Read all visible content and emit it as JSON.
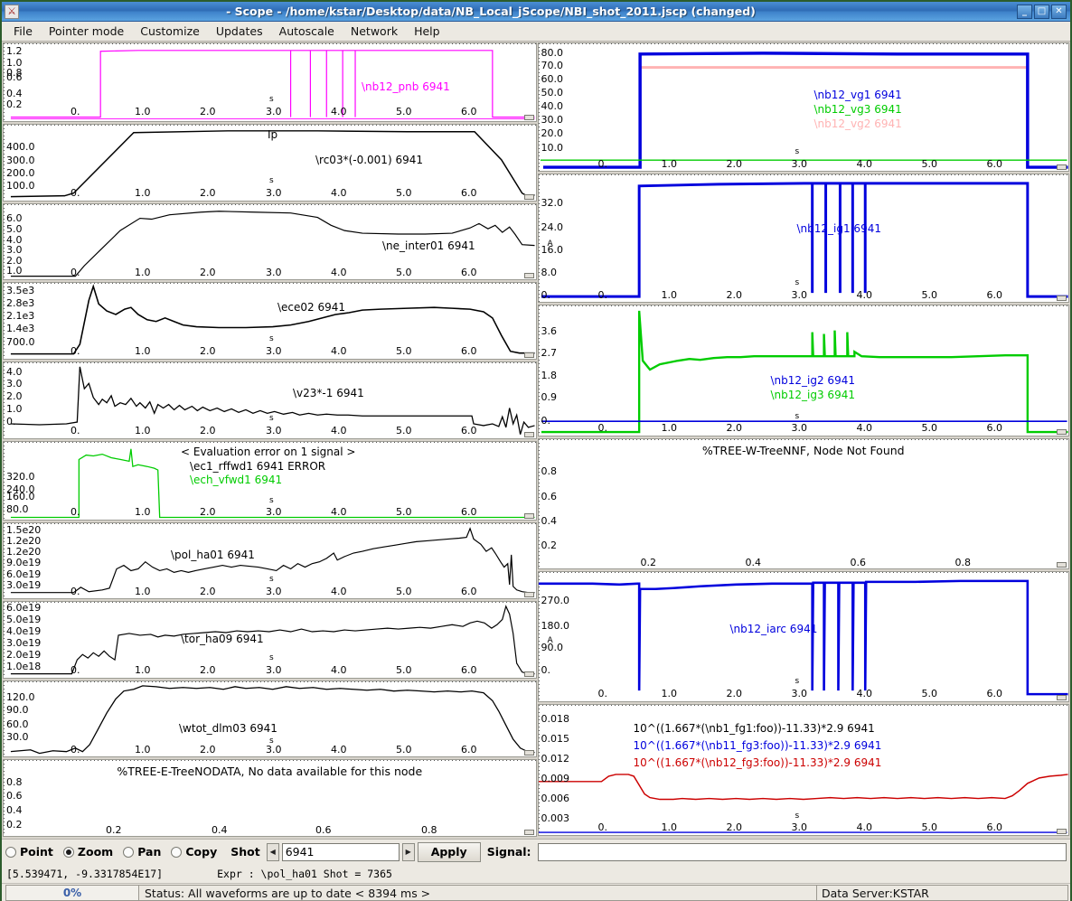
{
  "window": {
    "title": "- Scope - /home/kstar/Desktop/data/NB_Local_jScope/NBI_shot_2011.jscp (changed)",
    "minimize": "_",
    "maximize": "□",
    "close": "✕",
    "app_icon": "scope-app-icon"
  },
  "menu": [
    {
      "label": "File"
    },
    {
      "label": "Pointer mode"
    },
    {
      "label": "Customize"
    },
    {
      "label": "Updates"
    },
    {
      "label": "Autoscale"
    },
    {
      "label": "Network"
    },
    {
      "label": "Help"
    }
  ],
  "controls": {
    "modes": [
      {
        "label": "Point",
        "selected": false
      },
      {
        "label": "Zoom",
        "selected": true
      },
      {
        "label": "Pan",
        "selected": false
      },
      {
        "label": "Copy",
        "selected": false
      }
    ],
    "shot_label": "Shot",
    "shot_value": "6941",
    "spin_left": "◀",
    "spin_right": "▶",
    "apply_label": "Apply",
    "signal_label": "Signal:",
    "signal_value": ""
  },
  "infobar": {
    "coords": "[5.539471, -9.3317854E17]",
    "expr": "Expr : \\pol_ha01 Shot = 7365"
  },
  "statusbar": {
    "progress": "0%",
    "status": "Status: All waveforms are up to date < 8394 ms >",
    "data_server": "Data Server:KSTAR"
  },
  "colors": {
    "magenta": "#ff00ff",
    "black": "#000000",
    "green": "#00cc00",
    "blue": "#0000dd",
    "pink": "#ffb3b3",
    "red": "#cc0000"
  },
  "chart_data": [
    {
      "id": "nb12_pnb",
      "type": "line",
      "column": "left",
      "xlabel": "s",
      "xticks": [
        "0.",
        "1.0",
        "2.0",
        "3.0",
        "4.0",
        "5.0",
        "6.0"
      ],
      "yticks": [
        "1.2",
        "1.0",
        "0.8",
        "0.6",
        "0.4",
        "0.2"
      ],
      "xlim": [
        -0.55,
        6.9
      ],
      "ylim": [
        0.1,
        1.3
      ],
      "series": [
        {
          "name": "\\nb12_pnb 6941",
          "color": "#ff00ff",
          "note": "square pulse rising ~0.45s to ~1.25, several narrow dropouts between 3.0 and 4.0, falls at ~6.45s"
        }
      ]
    },
    {
      "id": "rc03",
      "type": "line",
      "column": "left",
      "xlabel": "s",
      "title_text": "Ip",
      "xticks": [
        "0.",
        "1.0",
        "2.0",
        "3.0",
        "4.0",
        "5.0",
        "6.0"
      ],
      "yticks": [
        "400.0",
        "300.0",
        "200.0",
        "100.0"
      ],
      "xlim": [
        -0.55,
        6.9
      ],
      "ylim": [
        0,
        520
      ],
      "series": [
        {
          "name": "\\rc03*(-0.001) 6941",
          "color": "#000000",
          "note": "flat-top plasma current: ramps 0.05s to 1.0s up to ~490, flat until 6.0s, ramps down to 0 by 6.75s"
        }
      ]
    },
    {
      "id": "ne_inter01",
      "type": "line",
      "column": "left",
      "xlabel": "s",
      "xticks": [
        "0.",
        "1.0",
        "2.0",
        "3.0",
        "4.0",
        "5.0",
        "6.0"
      ],
      "yticks": [
        "6.0",
        "5.0",
        "4.0",
        "3.0",
        "2.0",
        "1.0"
      ],
      "xlim": [
        -0.55,
        6.9
      ],
      "ylim": [
        0.8,
        7.2
      ],
      "series": [
        {
          "name": "\\ne_inter01 6941",
          "color": "#000000",
          "note": "density rises from 0.2s to ~6.8 at 1.0s, peak ~7.0 near 2.0s, decays to ~4.0 after 4.2s, bumps near 6.3s"
        }
      ]
    },
    {
      "id": "ece02",
      "type": "line",
      "column": "left",
      "xlabel": "s",
      "xticks": [
        "0.",
        "1.0",
        "2.0",
        "3.0",
        "4.0",
        "5.0",
        "6.0"
      ],
      "yticks": [
        "3.5e3",
        "2.8e3",
        "2.1e3",
        "1.4e3",
        "700.0"
      ],
      "xlim": [
        -0.55,
        6.9
      ],
      "ylim": [
        0,
        3800
      ],
      "series": [
        {
          "name": "\\ece02 6941",
          "color": "#000000",
          "note": "spike ~3600 at 0.4s, noisy decay to ~1500 at 2.5s, rises to ~2400 by 4.8s, drops at 6.4s"
        }
      ]
    },
    {
      "id": "v23",
      "type": "line",
      "column": "left",
      "xlabel": "s",
      "xticks": [
        "0.",
        "1.0",
        "2.0",
        "3.0",
        "4.0",
        "5.0",
        "6.0"
      ],
      "yticks": [
        "4.0",
        "3.0",
        "2.0",
        "1.0",
        "0."
      ],
      "xlim": [
        -0.55,
        6.9
      ],
      "ylim": [
        -0.5,
        4.5
      ],
      "series": [
        {
          "name": "\\v23*-1 6941",
          "color": "#000000",
          "note": "loop voltage: spike to 4.3 at 0.1s, oscillating decay to ~1.0, step down at 6.1s with spikes at 6.6s"
        }
      ]
    },
    {
      "id": "ech",
      "type": "line",
      "column": "left",
      "xlabel": "s",
      "xticks": [
        "0.",
        "1.0",
        "2.0",
        "3.0",
        "4.0",
        "5.0",
        "6.0"
      ],
      "yticks": [
        "320.0",
        "240.0",
        "160.0",
        "80.0"
      ],
      "xlim": [
        -0.55,
        6.9
      ],
      "ylim": [
        0,
        400
      ],
      "messages": [
        "< Evaluation error on 1 signal >"
      ],
      "series": [
        {
          "name": "\\ec1_rffwd1 6941 ERROR",
          "color": "#000000"
        },
        {
          "name": "\\ech_vfwd1 6941",
          "color": "#00cc00",
          "note": "ECH pulse ~340 from 0.1s to 1.25s then zero"
        }
      ]
    },
    {
      "id": "pol_ha01",
      "type": "line",
      "column": "left",
      "xlabel": "s",
      "xticks": [
        "0.",
        "1.0",
        "2.0",
        "3.0",
        "4.0",
        "5.0",
        "6.0"
      ],
      "yticks": [
        "1.5e20",
        "1.2e20",
        "1.2e20",
        "9.0e19",
        "6.0e19",
        "3.0e19"
      ],
      "xlim": [
        -0.55,
        6.9
      ],
      "ylim": [
        0,
        1.7e+20
      ],
      "series": [
        {
          "name": "\\pol_ha01 6941",
          "color": "#000000",
          "note": "H-alpha: ramp at 0.6s to 6e19, slow rise to 1.3e20 by 6.1s, spike then collapse after 6.3s"
        }
      ]
    },
    {
      "id": "tor_ha09",
      "type": "line",
      "column": "left",
      "xlabel": "s",
      "xticks": [
        "0.",
        "1.0",
        "2.0",
        "3.0",
        "4.0",
        "5.0",
        "6.0"
      ],
      "yticks": [
        "6.0e19",
        "5.0e19",
        "4.0e19",
        "3.0e19",
        "2.0e19",
        "1.0e18"
      ],
      "xlim": [
        -0.55,
        6.9
      ],
      "ylim": [
        0,
        7e+19
      ],
      "series": [
        {
          "name": "\\tor_ha09 6941",
          "color": "#000000",
          "note": "step at 0.55s to ~4.3e19, slow rise to 4.8e19, big spike at 6.4s then collapse"
        }
      ]
    },
    {
      "id": "wtot_dlm03",
      "type": "line",
      "column": "left",
      "xlabel": "s",
      "xticks": [
        "0.",
        "1.0",
        "2.0",
        "3.0",
        "4.0",
        "5.0",
        "6.0"
      ],
      "yticks": [
        "120.0",
        "90.0",
        "60.0",
        "30.0"
      ],
      "xlim": [
        -0.55,
        6.9
      ],
      "ylim": [
        0,
        150
      ],
      "series": [
        {
          "name": "\\wtot_dlm03 6941",
          "color": "#000000",
          "note": "stored energy rises 0.35s-1.1s to ~135, flat until 6.0s, decays to ~10 by 6.8s"
        }
      ]
    },
    {
      "id": "nodata",
      "type": "line",
      "column": "left",
      "xticks": [
        "0.2",
        "0.4",
        "0.6",
        "0.8"
      ],
      "yticks": [
        "0.8",
        "0.6",
        "0.4",
        "0.2"
      ],
      "xlim": [
        0,
        1
      ],
      "ylim": [
        0,
        1
      ],
      "messages": [
        "%TREE-E-TreeNODATA, No data available for this node"
      ],
      "series": []
    },
    {
      "id": "nb12_vg",
      "type": "line",
      "column": "right",
      "xlabel": "s",
      "xticks": [
        "0.",
        "1.0",
        "2.0",
        "3.0",
        "4.0",
        "5.0",
        "6.0"
      ],
      "yticks": [
        "80.0",
        "70.0",
        "60.0",
        "50.0",
        "40.0",
        "30.0",
        "20.0",
        "10.0"
      ],
      "xlim": [
        -0.6,
        6.9
      ],
      "ylim": [
        0,
        86
      ],
      "series": [
        {
          "name": "\\nb12_vg1 6941",
          "color": "#0000dd",
          "note": "square ~79 kV from 0.5s to 6.55s"
        },
        {
          "name": "\\nb12_vg3 6941",
          "color": "#00cc00",
          "note": "flat at zero"
        },
        {
          "name": "\\nb12_vg2 6941",
          "color": "#ffb3b3",
          "note": "square ~71 kV from 0.5s to 6.55s"
        }
      ]
    },
    {
      "id": "nb12_ig1",
      "type": "line",
      "column": "right",
      "xlabel": "A",
      "xticks": [
        "0.",
        "1.0",
        "2.0",
        "3.0",
        "4.0",
        "5.0",
        "6.0"
      ],
      "yticks": [
        "32.0",
        "24.0",
        "16.0",
        "8.0",
        "0."
      ],
      "xlim": [
        -0.6,
        6.9
      ],
      "ylim": [
        0,
        42
      ],
      "series": [
        {
          "name": "\\nb12_ig1 6941",
          "color": "#0000dd",
          "note": "square ~39 A from 0.5s to 6.55s with 5 narrow dropouts between 3.05 and 3.95s"
        }
      ]
    },
    {
      "id": "nb12_ig23",
      "type": "line",
      "column": "right",
      "xlabel": "s",
      "xticks": [
        "0.",
        "1.0",
        "2.0",
        "3.0",
        "4.0",
        "5.0",
        "6.0"
      ],
      "yticks": [
        "3.6",
        "2.7",
        "1.8",
        "0.9",
        "0."
      ],
      "xlim": [
        -0.6,
        6.9
      ],
      "ylim": [
        -0.15,
        4.3
      ],
      "series": [
        {
          "name": "\\nb12_ig2 6941",
          "color": "#0000dd",
          "note": "flat at zero"
        },
        {
          "name": "\\nb12_ig3 6941",
          "color": "#00cc00",
          "note": "spike to 4.2 at 0.5s, settles ~2.5-2.7, 4 narrow spikes 3.05-3.95s, drops at 6.5s"
        }
      ]
    },
    {
      "id": "treennf",
      "type": "line",
      "column": "right",
      "xticks": [
        "0.2",
        "0.4",
        "0.6",
        "0.8"
      ],
      "yticks": [
        "0.8",
        "0.6",
        "0.4",
        "0.2"
      ],
      "xlim": [
        0,
        1
      ],
      "ylim": [
        0,
        1
      ],
      "messages": [
        "%TREE-W-TreeNNF, Node Not Found"
      ],
      "series": []
    },
    {
      "id": "nb12_iarc",
      "type": "line",
      "column": "right",
      "xlabel": "A",
      "xticks": [
        "0.",
        "1.0",
        "2.0",
        "3.0",
        "4.0",
        "5.0",
        "6.0"
      ],
      "yticks": [
        "270.0",
        "180.0",
        "90.0",
        "0."
      ],
      "xlim": [
        -0.6,
        6.9
      ],
      "ylim": [
        0,
        390
      ],
      "series": [
        {
          "name": "\\nb12_iarc 6941",
          "color": "#0000dd",
          "note": "arc current ~350 A from start of trace, narrow dropouts near 0.5s and 3.05-3.95s, falls at 6.55s"
        }
      ]
    },
    {
      "id": "fg_expr",
      "type": "line",
      "column": "right",
      "xlabel": "s",
      "xticks": [
        "0.",
        "1.0",
        "2.0",
        "3.0",
        "4.0",
        "5.0",
        "6.0"
      ],
      "yticks": [
        "0.018",
        "0.015",
        "0.012",
        "0.009",
        "0.006",
        "0.003"
      ],
      "xlim": [
        -0.6,
        6.9
      ],
      "ylim": [
        0.001,
        0.0195
      ],
      "series": [
        {
          "name": "10^((1.667*(\\nb1_fg1:foo))-11.33)*2.9 6941",
          "color": "#000000"
        },
        {
          "name": "10^((1.667*(\\nb11_fg3:foo))-11.33)*2.9 6941",
          "color": "#0000dd"
        },
        {
          "name": "10^((1.667*(\\nb12_fg3:foo))-11.33)*2.9 6941",
          "color": "#cc0000",
          "note": "starts 0.0085, bump to 0.0093 at 0.3s, drops to 0.0055 at 0.9s, flat, rises to 0.0095 after 6.3s"
        }
      ]
    }
  ]
}
